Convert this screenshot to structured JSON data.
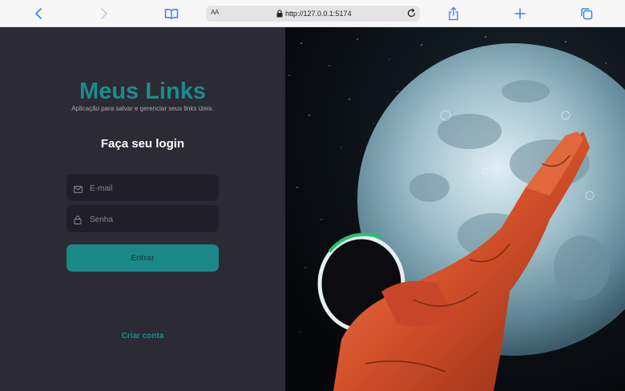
{
  "browser": {
    "url": "http://127.0.0.1:5174",
    "aa_label": "AA",
    "icons": [
      "back-icon",
      "forward-icon",
      "reader-icon",
      "lock-icon",
      "reload-icon",
      "share-icon",
      "new-tab-icon",
      "tabs-icon"
    ]
  },
  "login": {
    "brand": "Meus Links",
    "tagline": "Aplicação para salvar e gerenciar seus links úteis.",
    "title": "Faça seu login",
    "email_placeholder": "E-mail",
    "password_placeholder": "Senha",
    "submit_label": "Entrar",
    "create_account_label": "Criar conta"
  },
  "colors": {
    "accent": "#1b8c8c",
    "panel_bg": "#2c2a34",
    "input_bg": "#201f27",
    "space_bg": "#07090c"
  },
  "hero": {
    "image_subject": "astronaut-reaching-for-moon"
  }
}
